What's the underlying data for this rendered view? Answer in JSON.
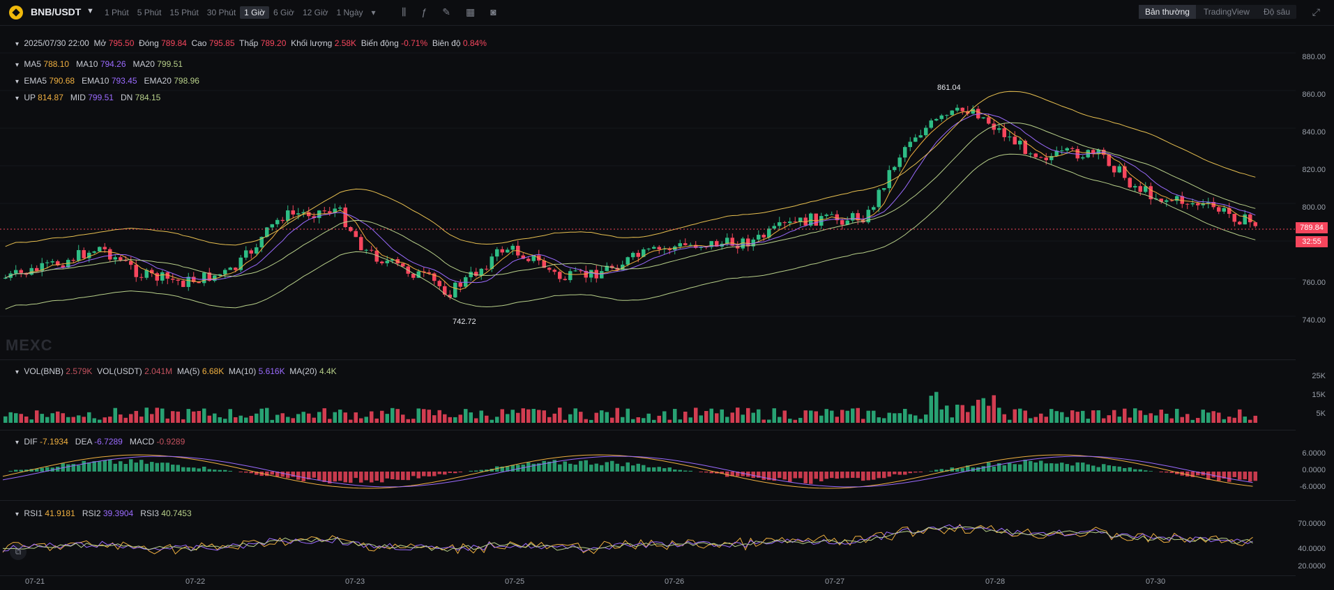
{
  "header": {
    "symbol": "BNB/USDT",
    "intervals": [
      "1 Phút",
      "5 Phút",
      "15 Phút",
      "30 Phút",
      "1 Giờ",
      "6 Giờ",
      "12 Giờ",
      "1 Ngày"
    ],
    "active_interval": "1 Giờ",
    "modes": [
      "Bản thường",
      "TradingView",
      "Độ sâu"
    ],
    "active_mode": "Bản thường"
  },
  "ohlc": {
    "date": "2025/07/30 22:00",
    "open_label": "Mở",
    "open": "795.50",
    "close_label": "Đóng",
    "close": "789.84",
    "high_label": "Cao",
    "high": "795.85",
    "low_label": "Thấp",
    "low": "789.20",
    "vol_label": "Khối lượng",
    "vol": "2.58K",
    "change_label": "Biến động",
    "change": "-0.71%",
    "amp_label": "Biên độ",
    "amp": "0.84%"
  },
  "ma": {
    "ma5_label": "MA5",
    "ma5": "788.10",
    "ma10_label": "MA10",
    "ma10": "794.26",
    "ma20_label": "MA20",
    "ma20": "799.51"
  },
  "ema": {
    "ema5_label": "EMA5",
    "ema5": "790.68",
    "ema10_label": "EMA10",
    "ema10": "793.45",
    "ema20_label": "EMA20",
    "ema20": "798.96"
  },
  "boll": {
    "up_label": "UP",
    "up": "814.87",
    "mid_label": "MID",
    "mid": "799.51",
    "dn_label": "DN",
    "dn": "784.15"
  },
  "price_axis": [
    "880.00",
    "860.00",
    "840.00",
    "820.00",
    "800.00",
    "760.00",
    "740.00"
  ],
  "last_price": "789.84",
  "countdown": "32:55",
  "high_marker": "861.04",
  "low_marker": "742.72",
  "watermark": "MEXC",
  "volume": {
    "vol_bnb_label": "VOL(BNB)",
    "vol_bnb": "2.579K",
    "vol_usdt_label": "VOL(USDT)",
    "vol_usdt": "2.041M",
    "ma5_label": "MA(5)",
    "ma5": "6.68K",
    "ma10_label": "MA(10)",
    "ma10": "5.616K",
    "ma20_label": "MA(20)",
    "ma20": "4.4K",
    "axis": [
      "25K",
      "15K",
      "5K"
    ]
  },
  "macd": {
    "dif_label": "DIF",
    "dif": "-7.1934",
    "dea_label": "DEA",
    "dea": "-6.7289",
    "macd_label": "MACD",
    "macd": "-0.9289",
    "axis": [
      "6.0000",
      "0.0000",
      "-6.0000"
    ]
  },
  "rsi": {
    "rsi1_label": "RSI1",
    "rsi1": "41.9181",
    "rsi2_label": "RSI2",
    "rsi2": "39.3904",
    "rsi3_label": "RSI3",
    "rsi3": "40.7453",
    "axis": [
      "70.0000",
      "40.0000",
      "20.0000"
    ]
  },
  "dates": [
    "07-21",
    "07-22",
    "07-23",
    "07-25",
    "07-26",
    "07-27",
    "07-28",
    "07-30"
  ],
  "colors": {
    "up": "#2ebd85",
    "down": "#f6465d",
    "ma5": "#f0b040",
    "ma10": "#9b6bff",
    "ma20": "#b8d08a",
    "boll": "#e8c050"
  }
}
